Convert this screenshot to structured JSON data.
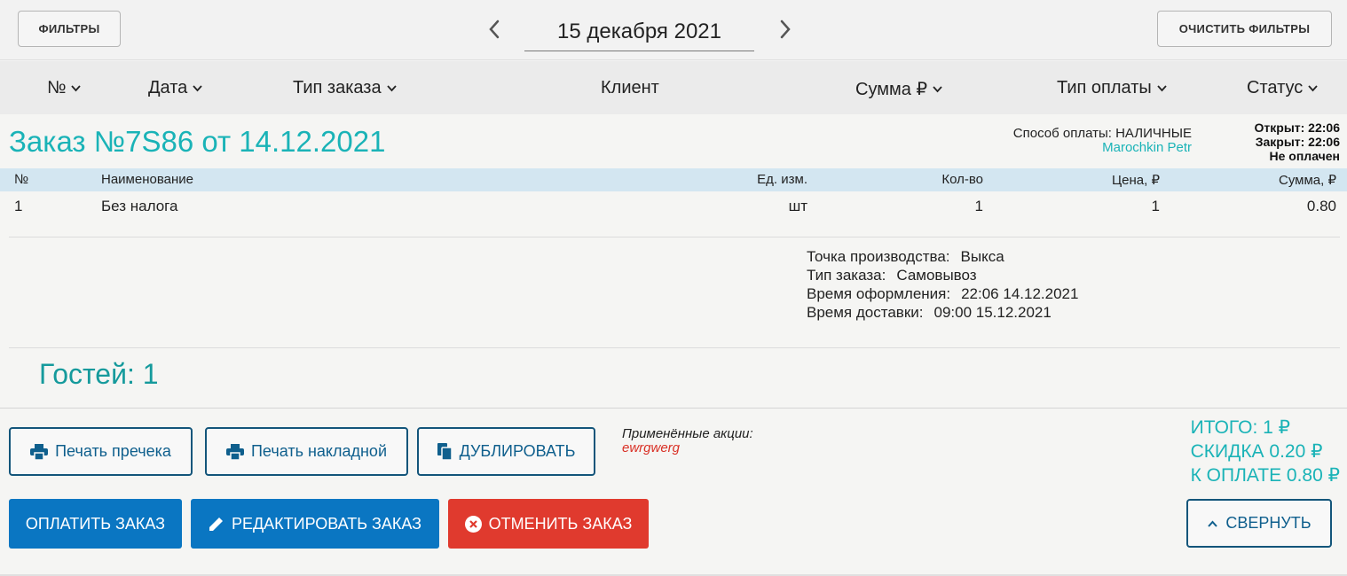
{
  "topbar": {
    "filters_label": "ФИЛЬТРЫ",
    "date": "15 декабря 2021",
    "clear_filters_label": "ОЧИСТИТЬ ФИЛЬТРЫ"
  },
  "columns": {
    "number": "№",
    "date": "Дата",
    "order_type": "Тип заказа",
    "client": "Клиент",
    "sum": "Сумма ₽",
    "payment_type": "Тип оплаты",
    "status": "Статус"
  },
  "order": {
    "title": "Заказ №7S86 от 14.12.2021",
    "payment_method": "Способ оплаты: НАЛИЧНЫЕ",
    "user": "Marochkin Petr",
    "opened": "Открыт: 22:06",
    "closed": "Закрыт: 22:06",
    "paid_status": "Не оплачен",
    "items_header": {
      "num": "№",
      "name": "Наименование",
      "unit": "Ед. изм.",
      "qty": "Кол-во",
      "price": "Цена, ₽",
      "sum": "Сумма, ₽"
    },
    "items": [
      {
        "num": "1",
        "name": "Без налога",
        "unit": "шт",
        "qty": "1",
        "price": "1",
        "sum": "0.80"
      }
    ],
    "info": {
      "production_label": "Точка производства:",
      "production_value": "Выкса",
      "type_label": "Тип заказа:",
      "type_value": "Самовывоз",
      "created_label": "Время оформления:",
      "created_value": "22:06 14.12.2021",
      "delivery_label": "Время доставки:",
      "delivery_value": "09:00 15.12.2021"
    },
    "guests": "Гостей: 1",
    "promo_label": "Применённые акции:",
    "promo_name": "ewrgwerg",
    "total": "ИТОГО: 1 ₽",
    "discount": "СКИДКА 0.20 ₽",
    "to_pay": "К ОПЛАТЕ 0.80 ₽"
  },
  "actions": {
    "print_precheck": "Печать пречека",
    "print_invoice": "Печать накладной",
    "duplicate": "ДУБЛИРОВАТЬ",
    "pay": "ОПЛАТИТЬ ЗАКАЗ",
    "edit": "РЕДАКТИРОВАТЬ ЗАКАЗ",
    "cancel": "ОТМЕНИТЬ ЗАКАЗ",
    "collapse": "СВЕРНУТЬ"
  },
  "colors": {
    "accent_teal": "#1ab3b7",
    "primary_blue": "#0a76c2",
    "danger_red": "#e03a2e",
    "items_header_bg": "#d3e6f1"
  }
}
